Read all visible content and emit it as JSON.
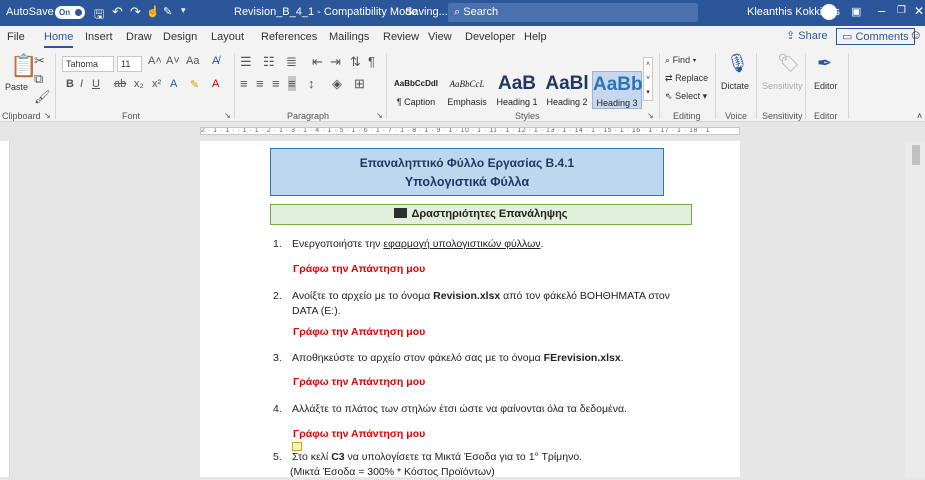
{
  "titlebar": {
    "autosave": "AutoSave",
    "autosave_state": "On",
    "doc_title": "Revision_B_4_1 - Compatibility Mode",
    "saving": "Saving...",
    "search": "Search",
    "user": "Kleanthis Kokkinos"
  },
  "tabs": {
    "file": "File",
    "home": "Home",
    "insert": "Insert",
    "draw": "Draw",
    "design": "Design",
    "layout": "Layout",
    "references": "References",
    "mailings": "Mailings",
    "review": "Review",
    "view": "View",
    "developer": "Developer",
    "help": "Help",
    "share": "Share",
    "comments": "Comments"
  },
  "ribbon": {
    "paste": "Paste",
    "font_name": "Tahoma",
    "font_size": "11",
    "styles": [
      {
        "preview": "AaBbCcDdI",
        "name": "¶ Caption"
      },
      {
        "preview": "AaBbCcL",
        "name": "Emphasis"
      },
      {
        "preview": "AaB",
        "name": "Heading 1"
      },
      {
        "preview": "AaBl",
        "name": "Heading 2"
      },
      {
        "preview": "AaBb",
        "name": "Heading 3"
      }
    ],
    "find": "Find",
    "replace": "Replace",
    "select": "Select",
    "dictate": "Dictate",
    "sensitivity": "Sensitivity",
    "editor": "Editor",
    "groups": {
      "clipboard": "Clipboard",
      "font": "Font",
      "paragraph": "Paragraph",
      "styles": "Styles",
      "editing": "Editing",
      "voice": "Voice",
      "sensitivity": "Sensitivity",
      "editor": "Editor"
    }
  },
  "ruler": {
    "text": "2 · 1 · 1 · · 1 · 1 · 2 · 1 · 3 · 1 · 4 · 1 · 5 · 1 · 6 · 1 · 7 · 1 · 8 · 1 · 9 · 1 · 10 · 1 · 11 · 1 · 12 · 1 · 13 · 1 · 14 · 1 · 15 · 1 · 16 · 1 · 17 · 1 · 18 · 1"
  },
  "doc": {
    "title1": "Επαναληπτικό Φύλλο Εργασίας Β.4.1",
    "title2": "Υπολογιστικά Φύλλα",
    "section": "Δραστηριότητες Επανάληψης",
    "answer": "Γράφω την Απάντηση μου",
    "items": [
      {
        "num": "1.",
        "pre": "Ενεργοποιήστε την ",
        "link": "εφαρμογή υπολογιστικών φύλλων",
        "post": "."
      },
      {
        "num": "2.",
        "pre": "Ανοίξτε το αρχείο με το όνομα ",
        "bold": "Revision.xlsx",
        "post": " από τον φάκελό ΒΟΗΘΗΜΑΤΑ στον DATA (E:)."
      },
      {
        "num": "3.",
        "pre": "Αποθηκεύστε το αρχείο στον φάκελό σας με το όνομα ",
        "bold": "FErevision.xlsx",
        "post": "."
      },
      {
        "num": "4.",
        "text": "Αλλάξτε το πλάτος των στηλών έτσι ώστε να φαίνονται όλα τα δεδομένα."
      },
      {
        "num": "5.",
        "pre": "Στο κελί  ",
        "bold": "C3",
        "post": " να υπολογίσετε τα Μικτά Έσοδα για το 1° Τρίμηνο.",
        "line2": "(Μικτά Έσοδα = 300% *  Κόστος Προϊόντων)"
      }
    ]
  }
}
